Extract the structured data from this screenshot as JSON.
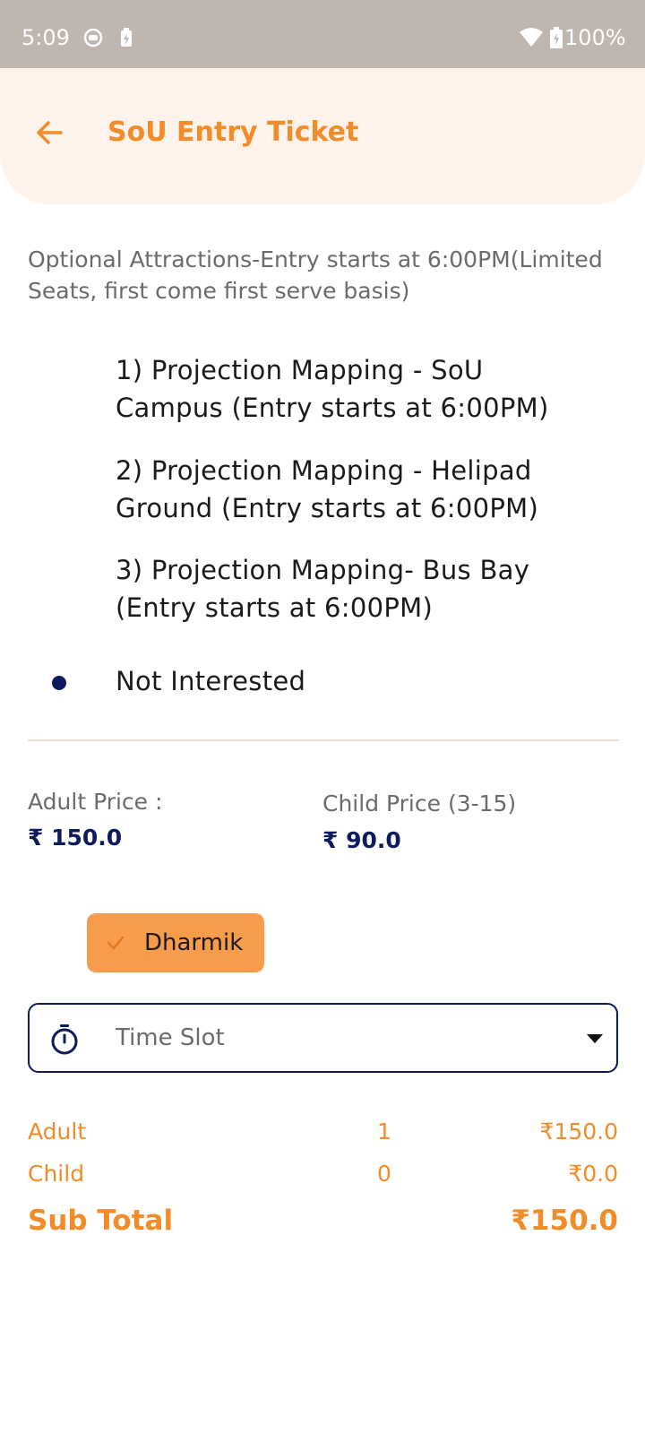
{
  "status_bar": {
    "time": "5:09",
    "battery_pct": "100%"
  },
  "header": {
    "title": "SoU Entry Ticket"
  },
  "intro": "Optional Attractions-Entry starts at 6:00PM(Limited Seats, first come first serve basis)",
  "options": [
    "1) Projection Mapping - SoU Campus (Entry starts at 6:00PM)",
    "2) Projection Mapping - Helipad Ground (Entry starts at 6:00PM)",
    "3) Projection Mapping- Bus Bay (Entry starts at 6:00PM)"
  ],
  "not_interested": "Not Interested",
  "prices": {
    "adult_label": "Adult Price :",
    "adult_value": "₹ 150.0",
    "child_label": "Child Price (3-15)",
    "child_value": "₹ 90.0"
  },
  "chip": {
    "label": "Dharmik"
  },
  "time_slot": {
    "placeholder": "Time Slot"
  },
  "summary": {
    "adult": {
      "label": "Adult",
      "qty": "1",
      "amount": "₹150.0"
    },
    "child": {
      "label": "Child",
      "qty": "0",
      "amount": "₹0.0"
    },
    "total": {
      "label": "Sub Total",
      "amount": "₹150.0"
    }
  },
  "colors": {
    "accent": "#f28c28",
    "navy": "#0d1b5e",
    "chip": "#f79c4a",
    "header_bg": "#fdf3ea",
    "status_bar": "#bfb6b0"
  }
}
